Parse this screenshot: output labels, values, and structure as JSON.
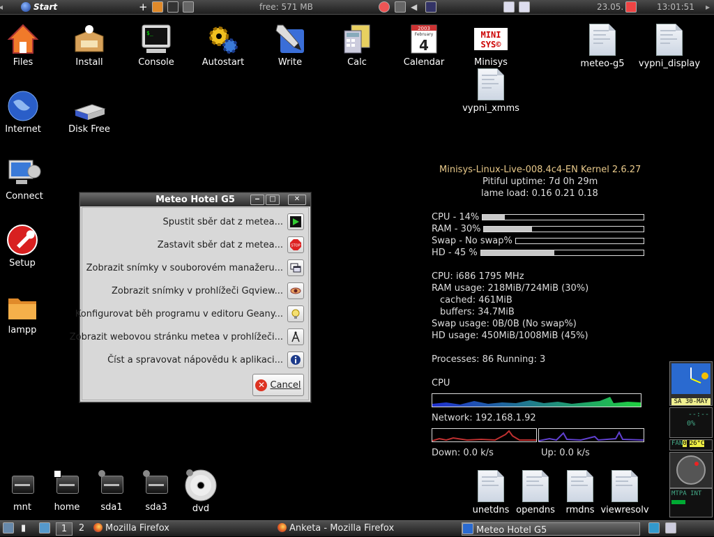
{
  "top_panel": {
    "start_label": "Start",
    "free_mem": "free: 571 MB",
    "date": "23.05.",
    "time": "13:01:51"
  },
  "desktop_icons": [
    {
      "label": "Files"
    },
    {
      "label": "Install"
    },
    {
      "label": "Console"
    },
    {
      "label": "Autostart"
    },
    {
      "label": "Write"
    },
    {
      "label": "Calc"
    },
    {
      "label": "Calendar"
    },
    {
      "label": "Minisys"
    },
    {
      "label": "meteo-g5"
    },
    {
      "label": "vypni_display"
    },
    {
      "label": "vypni_xmms"
    },
    {
      "label": "Internet"
    },
    {
      "label": "Disk Free"
    },
    {
      "label": "Connect"
    },
    {
      "label": "Setup"
    },
    {
      "label": "lampp"
    }
  ],
  "calendar_icon": {
    "year": "2003",
    "month": "February",
    "day": "4"
  },
  "minisys_logo": {
    "line1": "MINI",
    "line2": "SYS©"
  },
  "drives": [
    {
      "label": "mnt"
    },
    {
      "label": "home"
    },
    {
      "label": "sda1"
    },
    {
      "label": "sda3"
    },
    {
      "label": "dvd"
    }
  ],
  "dns_icons": [
    {
      "label": "unetdns"
    },
    {
      "label": "opendns"
    },
    {
      "label": "rmdns"
    },
    {
      "label": "viewresolv"
    }
  ],
  "conky": {
    "header": "Minisys-Linux-Live-008.4c4-EN Kernel 2.6.27",
    "uptime": "Pitiful uptime: 7d 0h 29m",
    "load": "lame load: 0.16 0.21 0.18",
    "cpu_label": "CPU - 14%",
    "cpu_fraction": 0.14,
    "ram_label": "RAM - 30%",
    "ram_fraction": 0.3,
    "swap_label": "Swap - No swap%",
    "swap_fraction": 0,
    "hd_label": "HD - 45 %",
    "hd_fraction": 0.45,
    "cpu_info": "CPU: i686 1795 MHz",
    "ram_usage": "RAM usage: 218MiB/724MiB (30%)",
    "cached": "cached: 461MiB",
    "buffers": "buffers: 34.7MiB",
    "swap_usage": "Swap usage: 0B/0B (No swap%)",
    "hd_usage": "HD usage: 450MiB/1008MiB (45%)",
    "processes": "Processes: 86  Running: 3",
    "cpu_graph_label": "CPU",
    "network": "Network: 192.168.1.92",
    "down": "Down: 0.0 k/s",
    "up": "Up: 0.0 k/s"
  },
  "window": {
    "title": "Meteo Hotel G5",
    "items": [
      {
        "label": "Spustit sběr dat z metea..."
      },
      {
        "label": "Zastavit sběr dat z metea..."
      },
      {
        "label": "Zobrazit snímky v souborovém manažeru..."
      },
      {
        "label": "Zobrazit snímky v prohlížeči Gqview..."
      },
      {
        "label": "Konfigurovat běh programu v editoru Geany..."
      },
      {
        "label": "Zobrazit webovou stránku metea v prohlížeči..."
      },
      {
        "label": "Číst a spravovat nápovědu k aplikaci..."
      }
    ],
    "cancel_label": "Cancel",
    "stop_text": "STOP"
  },
  "bottom_panel": {
    "workspace1": "1",
    "workspace2": "2",
    "tasks": [
      {
        "label": "Mozilla Firefox"
      },
      {
        "label": "Anketa - Mozilla Firefox"
      },
      {
        "label": "Meteo Hotel G5"
      }
    ]
  },
  "dock": {
    "date_text": "SA 30-MAY",
    "clock_text": "--:--",
    "pct": "0%",
    "fan_label": "FAN",
    "fan_val": "0",
    "temp": "26°C",
    "net_label": "MTPA INT"
  }
}
